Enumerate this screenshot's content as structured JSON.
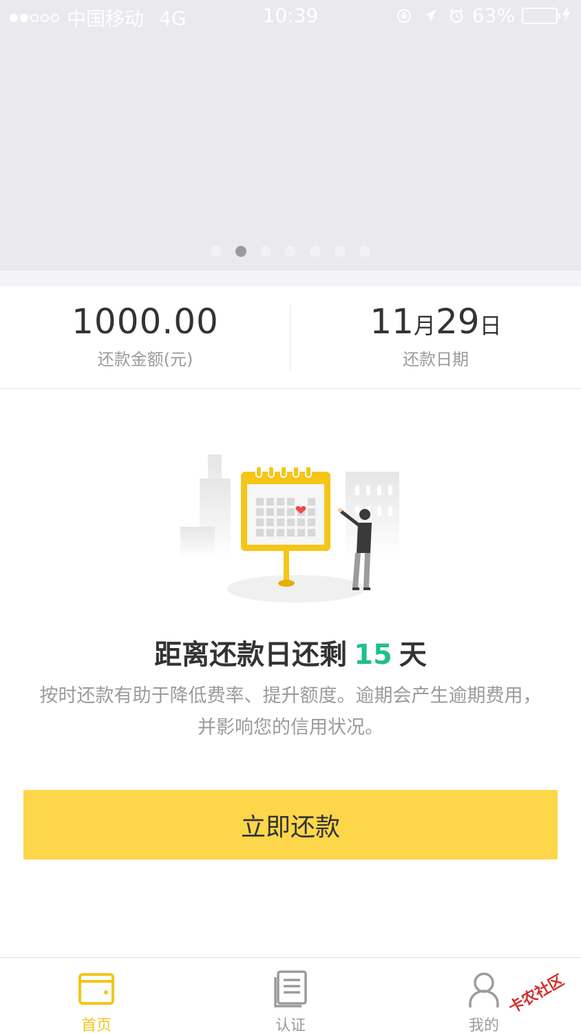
{
  "status_bar": {
    "carrier": "中国移动",
    "network": "4G",
    "time": "10:39",
    "battery": "63%",
    "battery_level": 0.63
  },
  "banner": {
    "page_count": 7,
    "active_index": 1
  },
  "stats": {
    "amount_value": "1000.00",
    "amount_label": "还款金额(元)",
    "date_month": "11",
    "date_month_unit": "月",
    "date_day": "29",
    "date_day_unit": "日",
    "date_label": "还款日期"
  },
  "countdown": {
    "prefix": "距离还款日还剩",
    "days": "15",
    "suffix": "天"
  },
  "tip": "按时还款有助于降低费率、提升额度。逾期会产生逾期费用，并影响您的信用状况。",
  "repay_button": "立即还款",
  "tabs": [
    {
      "label": "首页",
      "icon": "wallet-icon",
      "active": true
    },
    {
      "label": "认证",
      "icon": "document-icon",
      "active": false
    },
    {
      "label": "我的",
      "icon": "user-icon",
      "active": false
    }
  ],
  "watermark": "卡农社区",
  "colors": {
    "accent_yellow": "#fdd64a",
    "tab_active": "#f5c518",
    "days_green": "#1fbf8f",
    "battery_green": "#4cd964"
  }
}
